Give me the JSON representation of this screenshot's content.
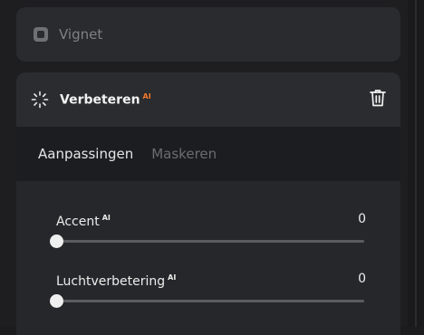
{
  "vignet": {
    "label": "Vignet"
  },
  "enhance": {
    "title": "Verbeteren",
    "ai_badge": "AI",
    "tabs": [
      {
        "label": "Aanpassingen",
        "active": true
      },
      {
        "label": "Maskeren",
        "active": false
      }
    ],
    "sliders": [
      {
        "label": "Accent",
        "ai": "AI",
        "value": "0",
        "level": 0.0
      },
      {
        "label": "Luchtverbetering",
        "ai": "AI",
        "value": "0",
        "level": 0.0
      }
    ]
  },
  "colors": {
    "accent_ai": "#f27a2a"
  }
}
